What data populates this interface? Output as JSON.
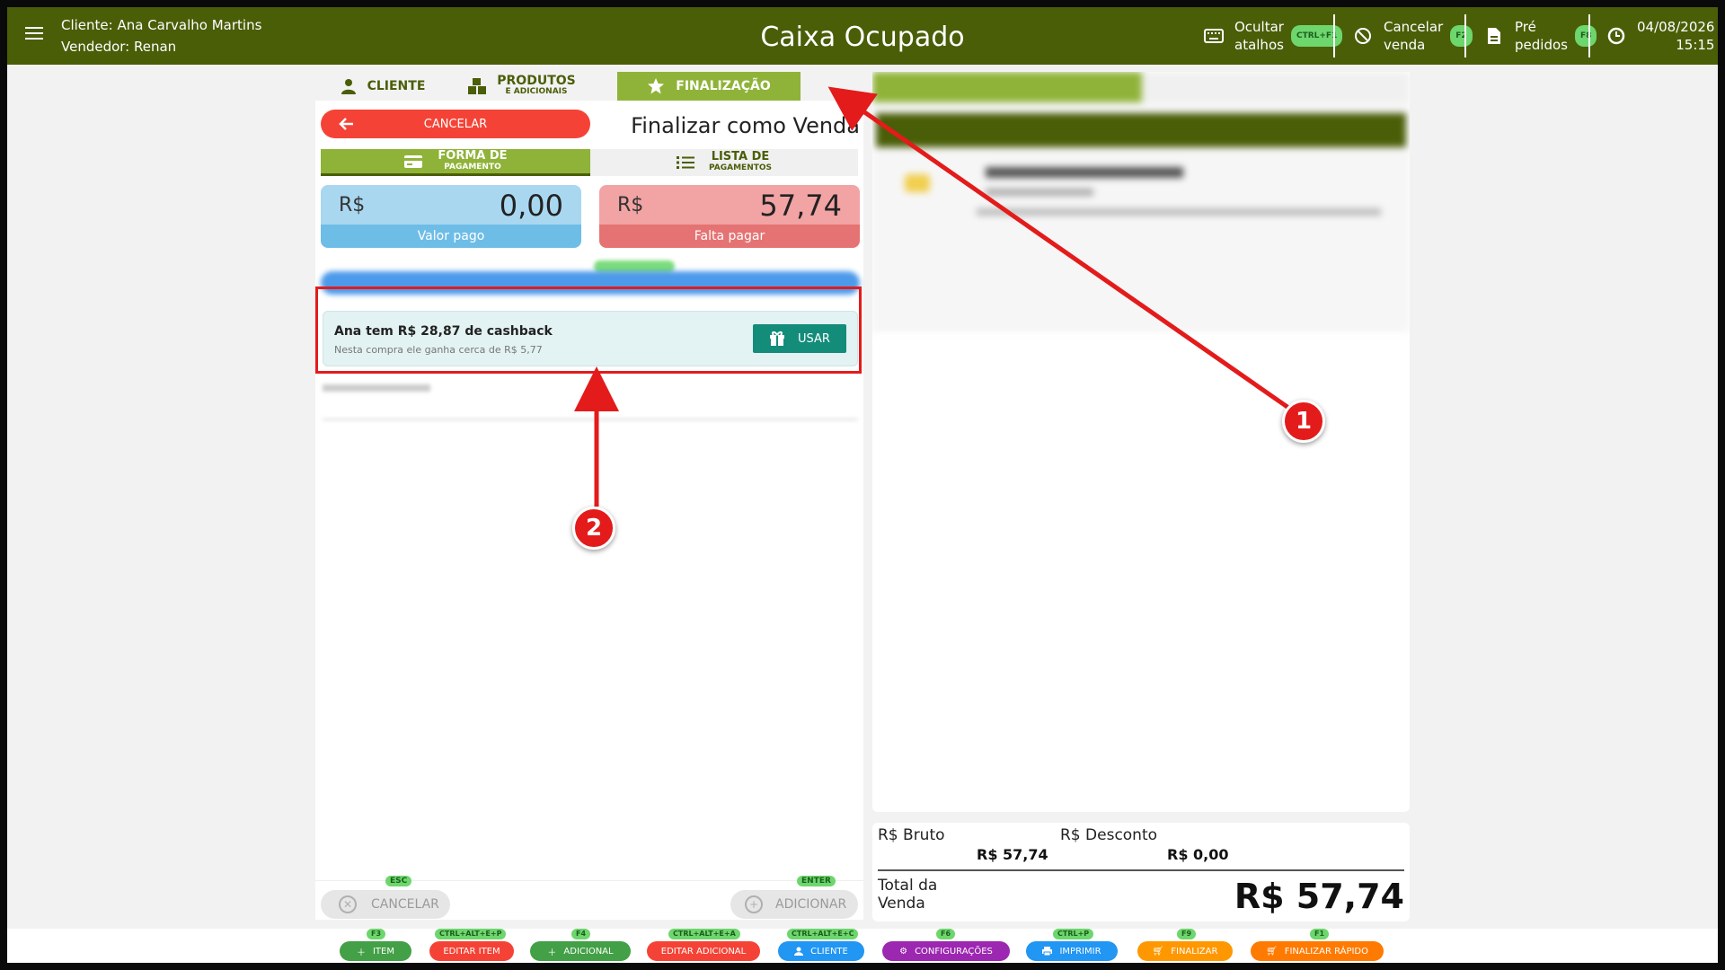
{
  "header": {
    "client_line": "Cliente: Ana Carvalho Martins",
    "seller_line": "Vendedor: Renan",
    "title": "Caixa Ocupado",
    "actions": [
      {
        "line1": "Ocultar",
        "line2": "atalhos",
        "key": "CTRL+F1"
      },
      {
        "line1": "Cancelar",
        "line2": "venda",
        "key": "F2"
      },
      {
        "line1": "Pré",
        "line2": "pedidos",
        "key": "F8"
      }
    ],
    "date": "04/08/2026",
    "time": "15:15"
  },
  "tabs": {
    "cliente": "CLIENTE",
    "produtos": "PRODUTOS",
    "produtos_sub": "E ADICIONAIS",
    "finalizacao": "FINALIZAÇÃO"
  },
  "left": {
    "cancel_label": "CANCELAR",
    "title": "Finalizar como Venda",
    "subtab_forma": "FORMA DE",
    "subtab_forma_sub": "PAGAMENTO",
    "subtab_lista": "LISTA DE",
    "subtab_lista_sub": "PAGAMENTOS",
    "paid": {
      "currency": "R$",
      "value": "0,00",
      "label": "Valor pago"
    },
    "due": {
      "currency": "R$",
      "value": "57,74",
      "label": "Falta pagar"
    },
    "cashback": {
      "title": "Ana tem R$ 28,87 de cashback",
      "subtitle": "Nesta compra ele ganha cerca de R$ 5,77",
      "button": "USAR"
    },
    "footer": {
      "cancel": "CANCELAR",
      "cancel_key": "ESC",
      "add": "ADICIONAR",
      "add_key": "ENTER"
    }
  },
  "totals": {
    "bruto_label": "R$ Bruto",
    "bruto_value": "R$ 57,74",
    "desconto_label": "R$ Desconto",
    "desconto_value": "R$ 0,00",
    "total_label_1": "Total da",
    "total_label_2": "Venda",
    "total_value": "R$ 57,74"
  },
  "bottombar": [
    {
      "label": "ITEM",
      "key": "F3",
      "color": "#43a047"
    },
    {
      "label": "EDITAR ITEM",
      "key": "CTRL+ALT+E+P",
      "color": "#f44336"
    },
    {
      "label": "ADICIONAL",
      "key": "F4",
      "color": "#43a047"
    },
    {
      "label": "EDITAR ADICIONAL",
      "key": "CTRL+ALT+E+A",
      "color": "#f44336"
    },
    {
      "label": "CLIENTE",
      "key": "CTRL+ALT+E+C",
      "color": "#2196f3"
    },
    {
      "label": "CONFIGURAÇÕES",
      "key": "F6",
      "color": "#9c27b0"
    },
    {
      "label": "IMPRIMIR",
      "key": "CTRL+P",
      "color": "#2196f3"
    },
    {
      "label": "FINALIZAR",
      "key": "F9",
      "color": "#ff9800"
    },
    {
      "label": "FINALIZAR RÁPIDO",
      "key": "F1",
      "color": "#ff7a00"
    }
  ],
  "annotations": {
    "badge1": "1",
    "badge2": "2",
    "color": "#e31b1b"
  }
}
